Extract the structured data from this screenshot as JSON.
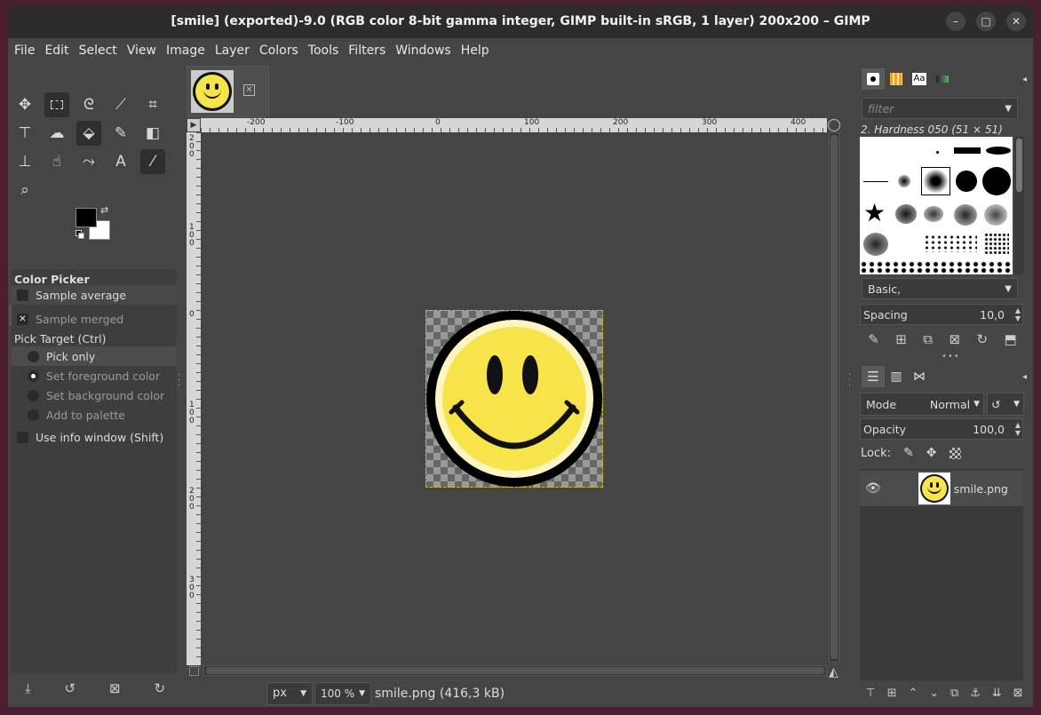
{
  "window": {
    "title": "[smile] (exported)-9.0 (RGB color 8-bit gamma integer, GIMP built-in sRGB, 1 layer) 200x200 – GIMP",
    "controls": [
      "–",
      "□",
      "✕"
    ]
  },
  "menu": [
    "File",
    "Edit",
    "Select",
    "View",
    "Image",
    "Layer",
    "Colors",
    "Tools",
    "Filters",
    "Windows",
    "Help"
  ],
  "tool_options": {
    "title": "Color Picker",
    "sample_average": "Sample average",
    "sample_merged": "Sample merged",
    "pick_target": "Pick Target  (Ctrl)",
    "targets": [
      "Pick only",
      "Set foreground color",
      "Set background color",
      "Add to palette"
    ],
    "use_info_window": "Use info window  (Shift)"
  },
  "rulers": {
    "h_labels": [
      "-200",
      "-100",
      "0",
      "100",
      "200",
      "300",
      "400"
    ],
    "v_labels": [
      "2\n0\n0",
      "1\n0\n0",
      "0",
      "1\n0\n0",
      "2\n0\n0",
      "3\n0\n0"
    ]
  },
  "status": {
    "unit": "px",
    "zoom": "100 %",
    "file_info": "smile.png (416,3 kB)"
  },
  "brushes": {
    "filter_placeholder": "filter",
    "selected": "2. Hardness 050 (51 × 51)",
    "tag": "Basic,",
    "spacing_label": "Spacing",
    "spacing_value": "10,0"
  },
  "layers": {
    "mode_label": "Mode",
    "mode_value": "Normal",
    "opacity_label": "Opacity",
    "opacity_value": "100,0",
    "lock_label": "Lock:",
    "items": [
      {
        "name": "smile.png",
        "visible": true
      }
    ]
  },
  "colors": {
    "foreground": "#000000",
    "background": "#ffffff",
    "smiley_yellow": "#f7e34a",
    "smiley_rim": "#fdf6c3"
  }
}
